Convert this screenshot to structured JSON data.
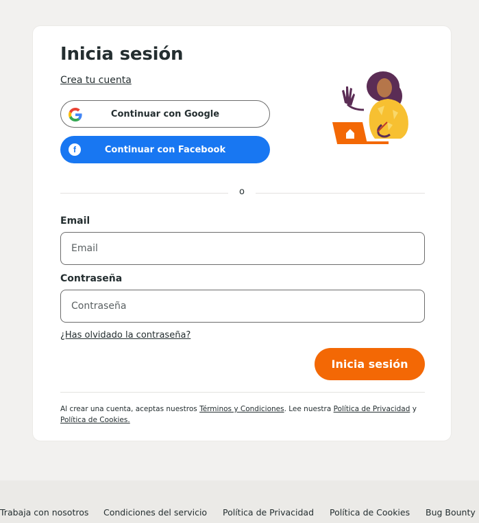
{
  "login": {
    "title": "Inicia sesión",
    "create_account_link": "Crea tu cuenta",
    "google_button": "Continuar con Google",
    "facebook_button": "Continuar con Facebook",
    "divider_text": "o",
    "email_label": "Email",
    "email_placeholder": "Email",
    "email_value": "",
    "password_label": "Contraseña",
    "password_placeholder": "Contraseña",
    "password_value": "",
    "forgot_link": "¿Has olvidado la contraseña?",
    "submit_button": "Inicia sesión"
  },
  "legal": {
    "text_1": "Al crear una cuenta, aceptas nuestros ",
    "terms_link": "Términos y Condiciones",
    "text_2": ". Lee nuestra ",
    "privacy_link": "Política de Privacidad",
    "text_3": " y ",
    "cookies_link": "Política de Cookies."
  },
  "footer": {
    "links": [
      "Trabaja con nosotros",
      "Condiciones del servicio",
      "Política de Privacidad",
      "Política de Cookies",
      "Bug Bounty"
    ]
  },
  "icons": {
    "google": "google-logo-icon",
    "facebook": "facebook-logo-icon",
    "illustration": "person-with-laptop-illustration"
  },
  "colors": {
    "brand_orange": "#f36805",
    "facebook_blue": "#1877f2",
    "page_background": "#f2f1ef",
    "text_dark": "#242e30"
  }
}
